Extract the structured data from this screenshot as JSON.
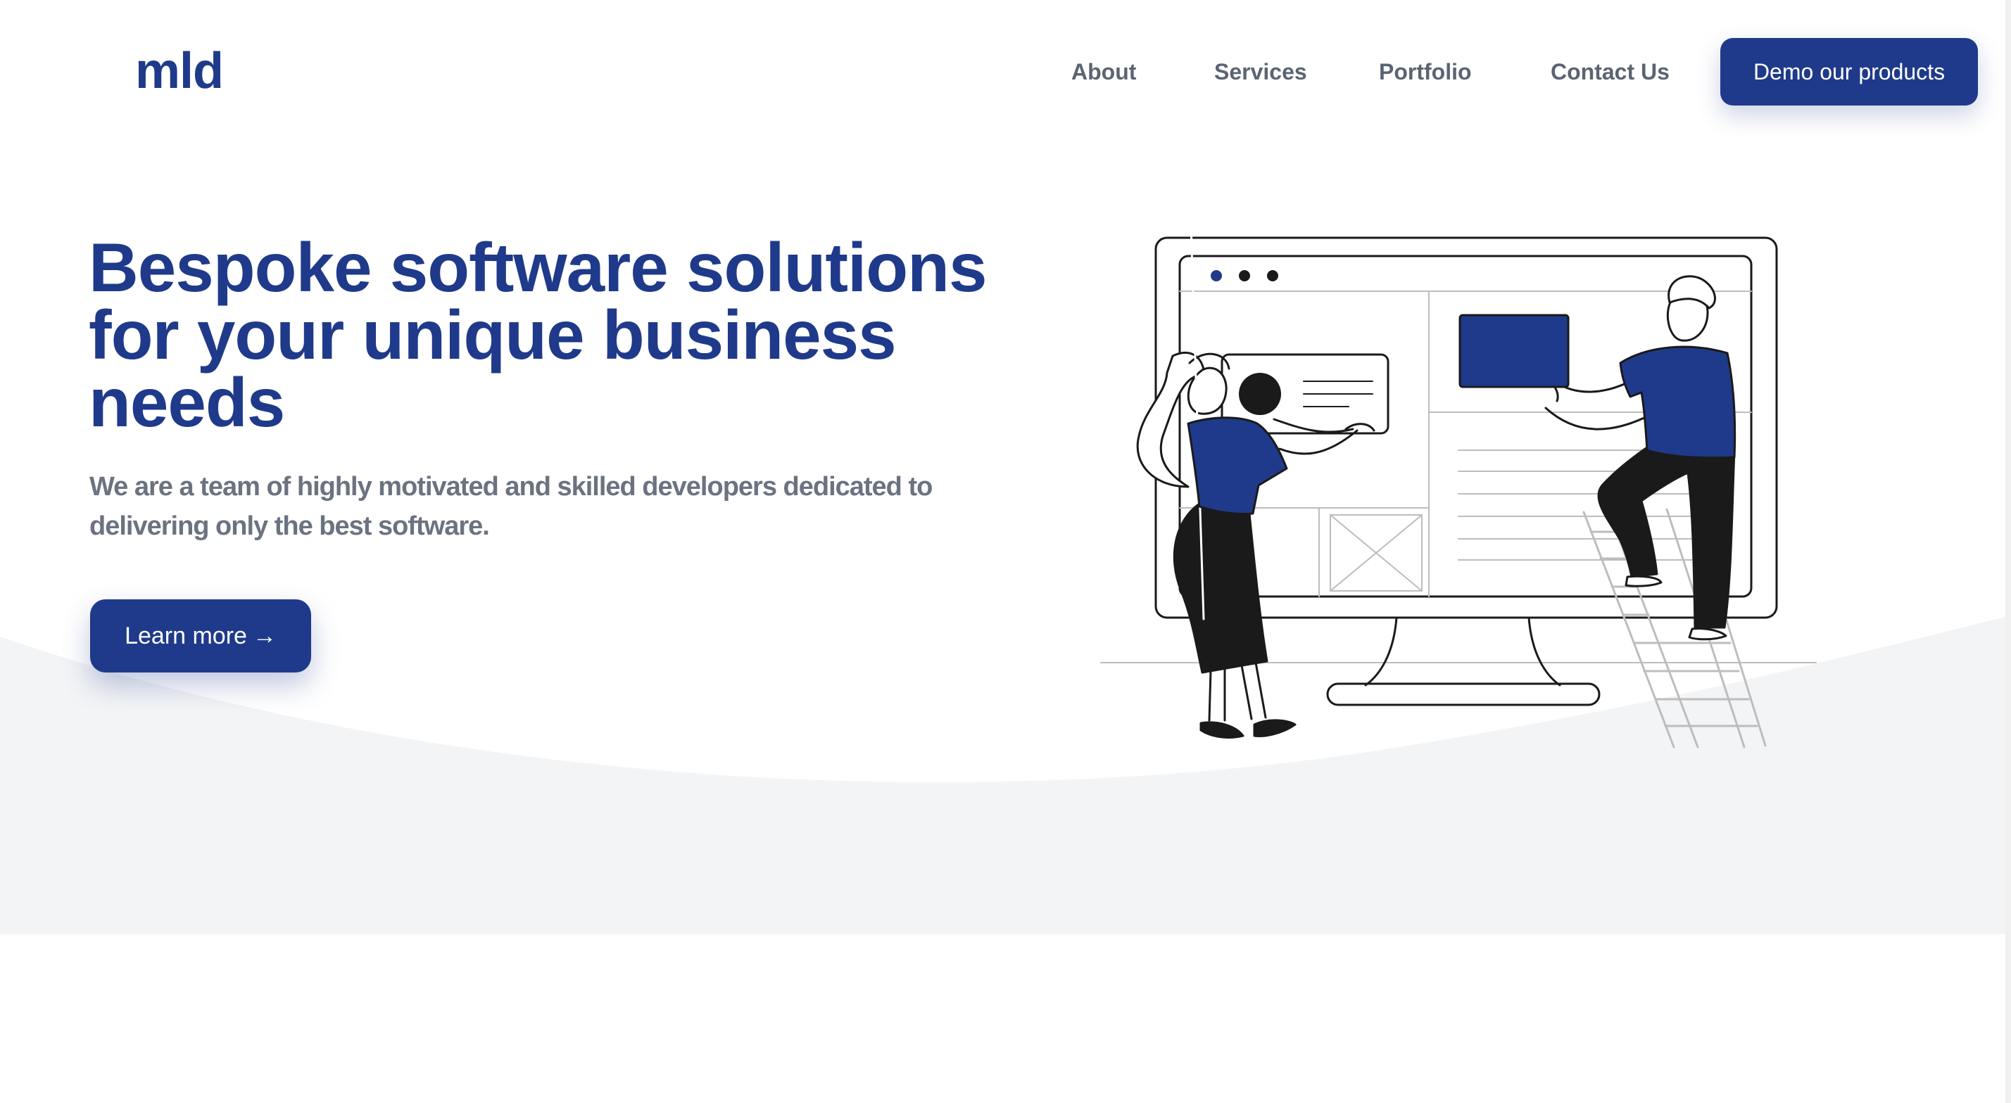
{
  "logo": {
    "text": "mld"
  },
  "nav": {
    "items": [
      {
        "label": "About"
      },
      {
        "label": "Services"
      },
      {
        "label": "Portfolio"
      },
      {
        "label": "Contact Us"
      }
    ],
    "cta_label": "Demo our products"
  },
  "hero": {
    "title": "Bespoke software solutions for your unique business needs",
    "subtitle": "We are a team of highly motivated and skilled developers dedicated to delivering only the best software.",
    "button_label": "Learn more",
    "button_icon": "arrow-right-icon"
  },
  "illustration": {
    "description_icon": "team-building-website-illustration"
  },
  "colors": {
    "brand": "#1f3a8a",
    "text_muted": "#6b7280",
    "nav_text": "#5b6472",
    "wave_bg": "#f3f4f6",
    "ink": "#1a1a1a"
  }
}
